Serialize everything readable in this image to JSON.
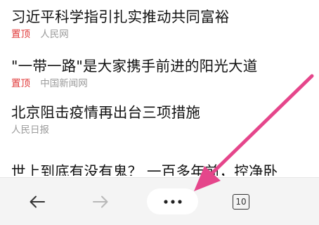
{
  "feed": {
    "items": [
      {
        "title": "习近平科学指引扎实推动共同富裕",
        "pin": "置顶",
        "source": "人民网"
      },
      {
        "title": "\"一带一路\"是大家携手前进的阳光大道",
        "pin": "置顶",
        "source": "中国新闻网"
      },
      {
        "title": "北京阻击疫情再出台三项措施",
        "source": "人民日报"
      },
      {
        "title": "世上到底有没有鬼？ 一百多年前，控净卧",
        "partially_hidden": true
      }
    ]
  },
  "toolbar": {
    "back_icon": "arrow-left-icon",
    "forward_icon": "arrow-right-icon",
    "forward_disabled": true,
    "menu_icon": "more-dots-icon",
    "tab_count": "10",
    "tab_icon": "tabs-icon"
  },
  "annotation": {
    "arrow_color": "#e5468b",
    "arrow_target": "menu-button"
  },
  "colors": {
    "pin_tag": "#e03a3a",
    "source_text": "#9b9b9b",
    "toolbar_bg": "#f4f4f4"
  }
}
